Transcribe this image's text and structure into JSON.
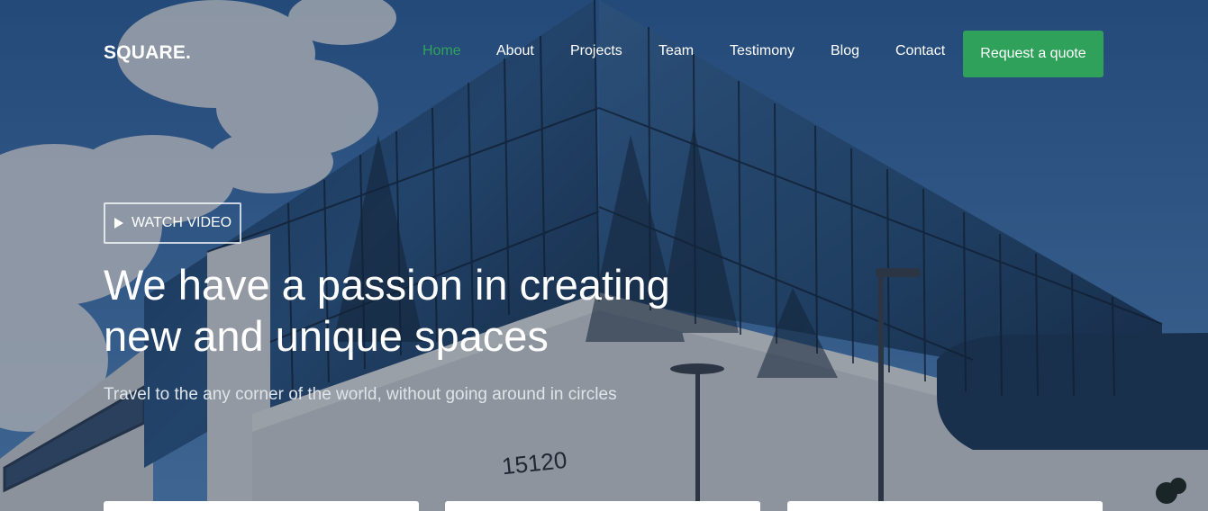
{
  "brand": {
    "name": "SQUARE",
    "dot": "."
  },
  "nav": {
    "items": [
      {
        "label": "Home",
        "active": true
      },
      {
        "label": "About",
        "active": false
      },
      {
        "label": "Projects",
        "active": false
      },
      {
        "label": "Team",
        "active": false
      },
      {
        "label": "Testimony",
        "active": false
      },
      {
        "label": "Blog",
        "active": false
      },
      {
        "label": "Contact",
        "active": false
      }
    ],
    "cta_label": "Request a quote"
  },
  "hero": {
    "video_label": "WATCH VIDEO",
    "headline_line1": "We have a passion in creating",
    "headline_line2": "new and unique spaces",
    "subheadline": "Travel to the any corner of the world, without going around in circles",
    "building_number": "15120"
  },
  "colors": {
    "accent": "#2fa15a",
    "active_link": "#2fa35a",
    "overlay": "#121e30",
    "sky": "#3f78b5"
  },
  "icons": {
    "video": "play-icon"
  }
}
